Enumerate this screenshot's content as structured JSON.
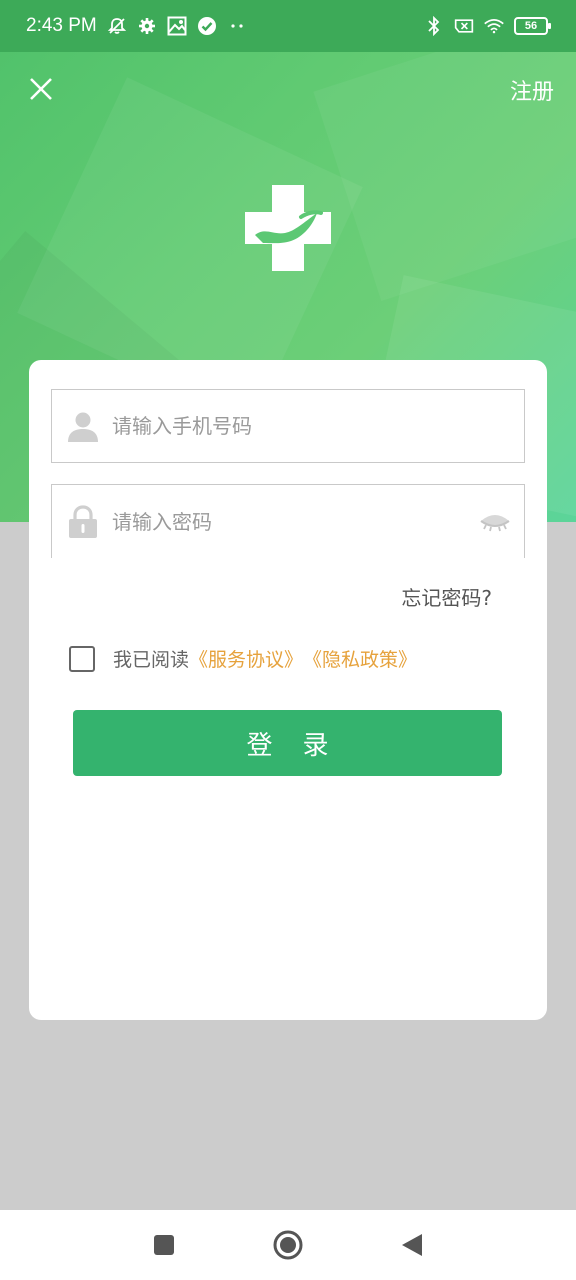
{
  "status_bar": {
    "time": "2:43 PM",
    "battery": "56",
    "icons_left": [
      "mute-icon",
      "settings-icon",
      "image-icon",
      "check-circle-icon",
      "more-dots-icon"
    ],
    "icons_right": [
      "bluetooth-icon",
      "sim-x-icon",
      "wifi-icon",
      "battery-icon"
    ]
  },
  "header": {
    "close_icon": "close-icon",
    "register_label": "注册",
    "logo_icon": "medical-cross-hand-icon"
  },
  "form": {
    "phone": {
      "placeholder": "请输入手机号码",
      "value": "",
      "icon": "user-icon"
    },
    "password": {
      "placeholder": "请输入密码",
      "value": "",
      "icon": "lock-icon",
      "toggle_icon": "eye-closed-icon"
    },
    "forgot_label": "忘记密码?",
    "agree": {
      "checked": false,
      "prefix": "我已阅读",
      "service_link": "《服务协议》",
      "privacy_link": "《隐私政策》"
    },
    "login_label": "登录"
  },
  "nav_bar": {
    "icons": [
      "recent-apps-icon",
      "home-icon",
      "back-icon"
    ]
  },
  "colors": {
    "header_green": "#62cb73",
    "status_green": "#3daa58",
    "button_green": "#34b36e",
    "link_orange": "#e6a23c",
    "background_gray": "#cccccc"
  }
}
